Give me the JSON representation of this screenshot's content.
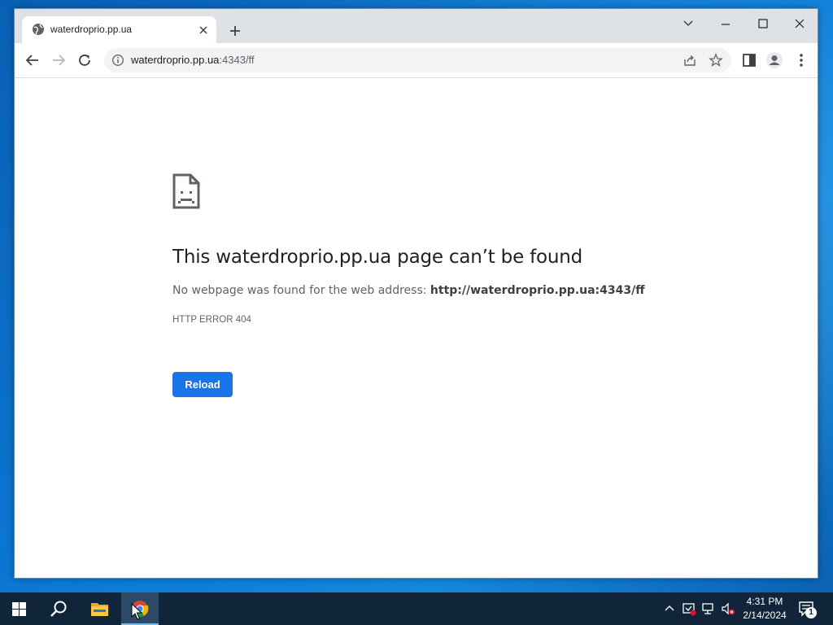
{
  "browser": {
    "tab": {
      "title": "waterdroprio.pp.ua"
    },
    "address": {
      "host": "waterdroprio.pp.ua",
      "path": ":4343/ff"
    }
  },
  "error_page": {
    "heading": "This waterdroprio.pp.ua page can’t be found",
    "description_prefix": "No webpage was found for the web address: ",
    "description_url": "http://waterdroprio.pp.ua:4343/ff",
    "error_code": "HTTP ERROR 404",
    "reload_label": "Reload"
  },
  "taskbar": {
    "time": "4:31 PM",
    "date": "2/14/2024",
    "notification_count": "1",
    "apps": [
      "start-icon",
      "search-icon",
      "file-explorer-icon",
      "chrome-icon"
    ]
  },
  "colors": {
    "accent": "#1a73e8",
    "taskbar": "#10253a",
    "desktop": "#0b7ad6"
  }
}
